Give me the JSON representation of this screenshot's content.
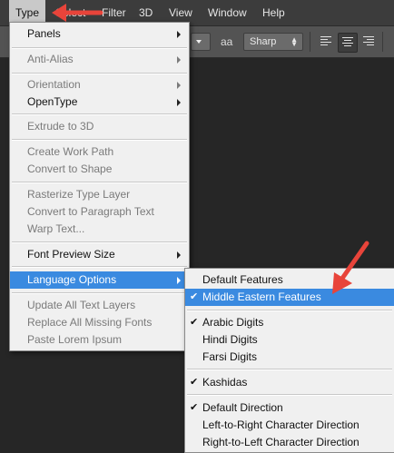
{
  "menubar": {
    "items": [
      {
        "label": "Type",
        "active": true
      },
      {
        "label": "Select"
      },
      {
        "label": "Filter"
      },
      {
        "label": "3D"
      },
      {
        "label": "View"
      },
      {
        "label": "Window"
      },
      {
        "label": "Help"
      }
    ]
  },
  "optionsbar": {
    "size_glyph": "aa",
    "antialias_value": "Sharp",
    "align_options": [
      "align-left",
      "align-center",
      "align-right"
    ],
    "selected_align": "align-center"
  },
  "type_menu": {
    "items": [
      {
        "label": "Panels",
        "submenu": true,
        "enabled": true
      },
      {
        "sep": true
      },
      {
        "label": "Anti-Alias",
        "submenu": true,
        "enabled": false
      },
      {
        "sep": true
      },
      {
        "label": "Orientation",
        "submenu": true,
        "enabled": false
      },
      {
        "label": "OpenType",
        "submenu": true,
        "enabled": true
      },
      {
        "sep": true
      },
      {
        "label": "Extrude to 3D",
        "enabled": false
      },
      {
        "sep": true
      },
      {
        "label": "Create Work Path",
        "enabled": false
      },
      {
        "label": "Convert to Shape",
        "enabled": false
      },
      {
        "sep": true
      },
      {
        "label": "Rasterize Type Layer",
        "enabled": false
      },
      {
        "label": "Convert to Paragraph Text",
        "enabled": false
      },
      {
        "label": "Warp Text...",
        "enabled": false
      },
      {
        "sep": true
      },
      {
        "label": "Font Preview Size",
        "submenu": true,
        "enabled": true
      },
      {
        "sep": true
      },
      {
        "label": "Language Options",
        "submenu": true,
        "enabled": true,
        "highlighted": true
      },
      {
        "sep": true
      },
      {
        "label": "Update All Text Layers",
        "enabled": false
      },
      {
        "label": "Replace All Missing Fonts",
        "enabled": false
      },
      {
        "label": "Paste Lorem Ipsum",
        "enabled": false
      }
    ]
  },
  "language_submenu": {
    "items": [
      {
        "label": "Default Features",
        "checked": false
      },
      {
        "label": "Middle Eastern Features",
        "checked": true,
        "highlighted": true
      },
      {
        "sep": true
      },
      {
        "label": "Arabic Digits",
        "checked": true
      },
      {
        "label": "Hindi Digits",
        "checked": false
      },
      {
        "label": "Farsi Digits",
        "checked": false
      },
      {
        "sep": true
      },
      {
        "label": "Kashidas",
        "checked": true
      },
      {
        "sep": true
      },
      {
        "label": "Default Direction",
        "checked": true
      },
      {
        "label": "Left-to-Right Character Direction",
        "checked": false
      },
      {
        "label": "Right-to-Left Character Direction",
        "checked": false
      }
    ]
  },
  "colors": {
    "highlight": "#3a8ae0",
    "annotation_arrow": "#e8443a"
  },
  "check_glyph": "✔"
}
